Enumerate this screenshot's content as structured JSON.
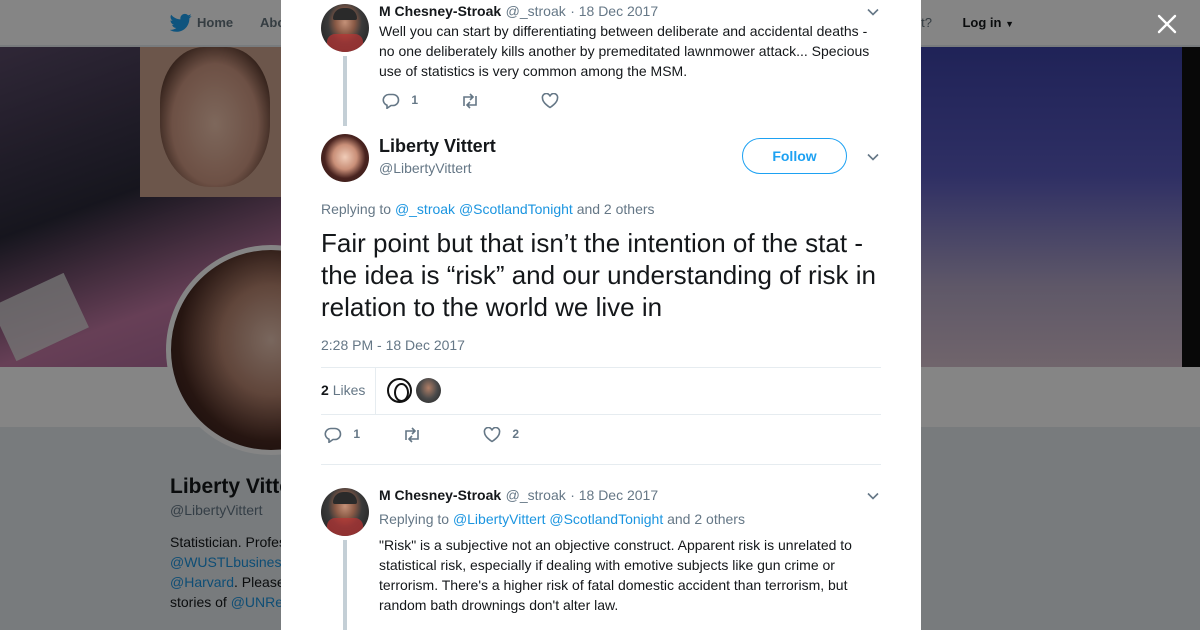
{
  "nav": {
    "home": "Home",
    "about": "Abo",
    "account_text": "ccount?",
    "login": "Log in"
  },
  "profile": {
    "name": "Liberty Vitte",
    "handle": "@LibertyVittert",
    "bio_line1": "Statistician. Profes",
    "bio_link1": "@WUSTLbusines",
    "bio_link2": "@Harvard",
    "bio_line3_suffix": ". Please",
    "bio_line4_prefix": "stories of ",
    "bio_link3": "@UNRe"
  },
  "close_icon": "close-icon",
  "tweet1": {
    "author": "M Chesney-Stroak",
    "handle": "@_stroak",
    "date": "· 18 Dec 2017",
    "text": "Well you can start by differentiating between deliberate and accidental deaths - no one deliberately kills another by premeditated lawnmower attack... Specious use of statistics is very common among the MSM.",
    "replies": "1"
  },
  "main_tweet": {
    "author": "Liberty Vittert",
    "handle": "@LibertyVittert",
    "follow_label": "Follow",
    "replying_prefix": "Replying to",
    "reply_to_1": "@_stroak",
    "reply_to_2": "@ScotlandTonight",
    "replying_suffix": "and 2 others",
    "text": "Fair point but that isn’t the intention of the stat - the idea is “risk” and our understanding of risk in relation to the world we live in",
    "timestamp": "2:28 PM - 18 Dec 2017",
    "likes_count": "2",
    "likes_label": "Likes",
    "replies": "1",
    "like_count_action": "2"
  },
  "tweet3": {
    "author": "M Chesney-Stroak",
    "handle": "@_stroak",
    "date": "· 18 Dec 2017",
    "replying_prefix": "Replying to",
    "reply_to_1": "@LibertyVittert",
    "reply_to_2": "@ScotlandTonight",
    "replying_suffix": "and 2 others",
    "text": "\"Risk\" is a subjective not an objective construct. Apparent risk is unrelated to statistical risk, especially if dealing with emotive subjects like gun crime or terrorism. There's a higher risk of fatal domestic accident than terrorism, but random bath drownings don't alter law."
  },
  "colors": {
    "accent": "#1da1f2",
    "link": "#1b95e0",
    "muted": "#657786",
    "thread_line": "#c4cfd6"
  }
}
